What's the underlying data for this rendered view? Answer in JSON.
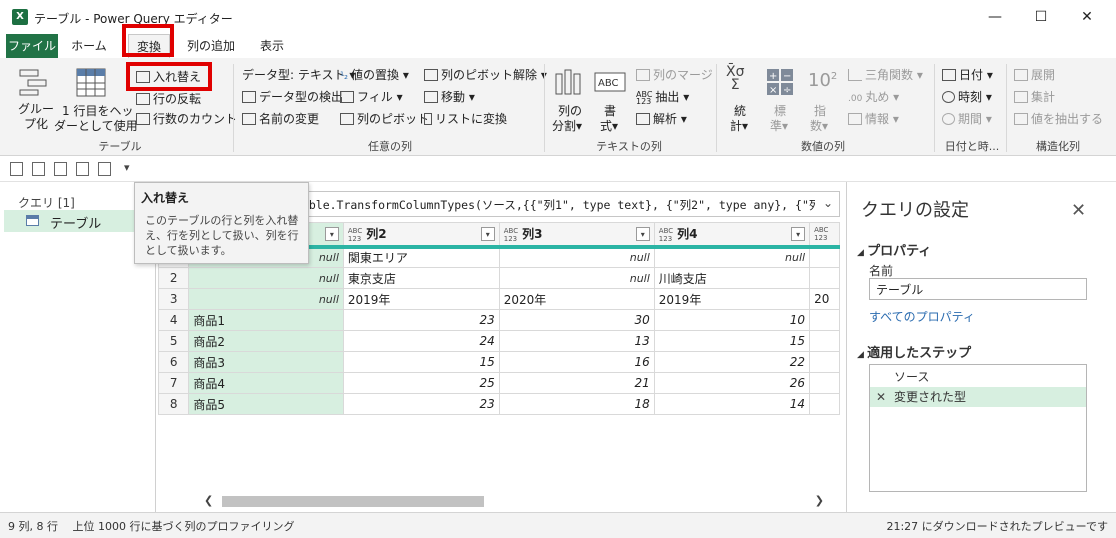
{
  "window": {
    "app_icon": "X",
    "title": "テーブル - Power Query エディター",
    "minimize": "—",
    "maximize": "☐",
    "close": "✕"
  },
  "tabs": [
    "ファイル",
    "ホーム",
    "変換",
    "列の追加",
    "表示"
  ],
  "ribbon": {
    "table_group": {
      "group_by": "グルー\nプ化",
      "first_row_header_1": "1 行目をヘッ",
      "first_row_header_2": "ダーとして使用",
      "transpose": "入れ替え",
      "reverse_rows": "行の反転",
      "count_rows": "行数のカウント",
      "label": "テーブル"
    },
    "any_column_group": {
      "data_type": "データ型: テキスト",
      "detect_type": "データ型の検出",
      "rename": "名前の変更",
      "replace_values": "値の置換",
      "fill": "フィル",
      "pivot": "列のピボット",
      "unpivot": "列のピボット解除",
      "move": "移動",
      "to_list": "リストに変換",
      "label": "任意の列"
    },
    "text_group": {
      "split_1": "列の",
      "split_2": "分割",
      "format_1": "書",
      "format_2": "式",
      "merge": "列のマージ",
      "extract": "抽出",
      "parse": "解析",
      "label": "テキストの列"
    },
    "number_group": {
      "stats_1": "統",
      "stats_2": "計",
      "standard_1": "標",
      "standard_2": "準",
      "scientific_1": "指",
      "scientific_2": "数",
      "trig": "三角関数",
      "rounding": "丸め",
      "info": "情報",
      "label": "数値の列"
    },
    "datetime_group": {
      "date": "日付",
      "time": "時刻",
      "duration": "期間",
      "label": "日付と時..."
    },
    "structured_group": {
      "expand": "展開",
      "aggregate": "集計",
      "extract_values": "値を抽出する",
      "label": "構造化列"
    }
  },
  "queries": {
    "title": "クエリ [1]",
    "items": [
      "テーブル"
    ]
  },
  "tooltip": {
    "title": "入れ替え",
    "body": "このテーブルの行と列を入れ替え、行を列として扱い、列を行として扱います。"
  },
  "formula": {
    "prefix": "=",
    "text": "Table.TransformColumnTypes(ソース,{{\"列1\", type text}, {\"列2\", type any}, {\"列"
  },
  "grid": {
    "columns": [
      {
        "type": "ABC\n123",
        "name": "列2"
      },
      {
        "type": "ABC\n123",
        "name": "列3"
      },
      {
        "type": "ABC\n123",
        "name": "列4"
      },
      {
        "type": "ABC\n123",
        "name": ""
      }
    ],
    "rows": [
      {
        "n": "1",
        "c1": "null",
        "c2": "関東エリア",
        "c3": "null",
        "c4": "null"
      },
      {
        "n": "2",
        "c1": "null",
        "c2": "東京支店",
        "c3": "null",
        "c4": "川崎支店"
      },
      {
        "n": "3",
        "c1": "null",
        "c2": "2019年",
        "c3": "2020年",
        "c4": "2019年",
        "c5": "20"
      },
      {
        "n": "4",
        "c1": "商品1",
        "c2": "23",
        "c3": "30",
        "c4": "10"
      },
      {
        "n": "5",
        "c1": "商品2",
        "c2": "24",
        "c3": "13",
        "c4": "15"
      },
      {
        "n": "6",
        "c1": "商品3",
        "c2": "15",
        "c3": "16",
        "c4": "22"
      },
      {
        "n": "7",
        "c1": "商品4",
        "c2": "25",
        "c3": "21",
        "c4": "26"
      },
      {
        "n": "8",
        "c1": "商品5",
        "c2": "23",
        "c3": "18",
        "c4": "14"
      }
    ]
  },
  "settings": {
    "title": "クエリの設定",
    "close": "✕",
    "properties_heading": "プロパティ",
    "name_label": "名前",
    "name_value": "テーブル",
    "all_properties": "すべてのプロパティ",
    "steps_heading": "適用したステップ",
    "steps": [
      "ソース",
      "変更された型"
    ]
  },
  "status": {
    "left": "9 列, 8 行　 上位 1000 行に基づく列のプロファイリング",
    "right": "21:27 にダウンロードされたプレビューです"
  },
  "colors": {
    "accent_green": "#217346",
    "selected_fill": "#d7efe0",
    "highlight_red": "#e00000",
    "header_stripe": "#2bb4a4"
  }
}
